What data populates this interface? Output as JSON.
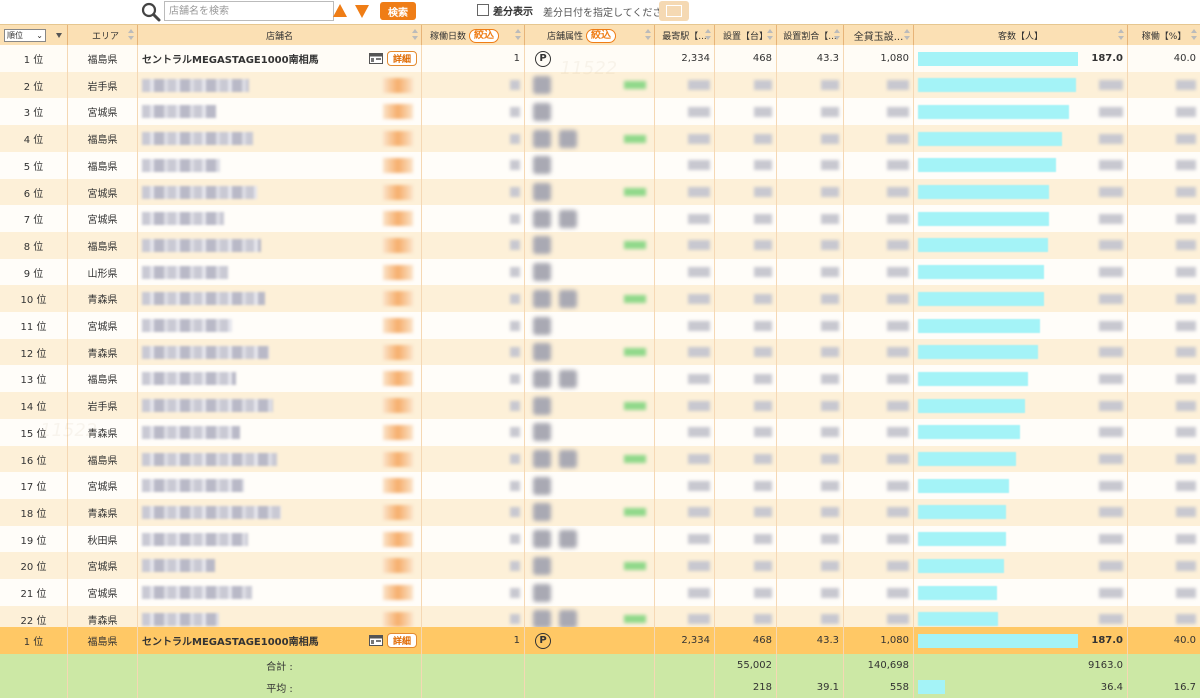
{
  "toolbar": {
    "search_placeholder": "店舗名を検索",
    "search_button": "検索",
    "diff_label": "差分表示",
    "diff_hint": "差分日付を指定してください"
  },
  "columns": {
    "rank": "順位",
    "area": "エリア",
    "name": "店舗名",
    "days": "稼働日数",
    "days_filter": "絞込",
    "attr": "店舗属性",
    "attr_filter": "絞込",
    "station": "最寄駅【...",
    "machines": "設置【台】",
    "ratio": "設置割合【...",
    "rental": "全貸玉設...",
    "customers": "客数【人】",
    "rate": "稼働【%】"
  },
  "detail_label": "詳細",
  "rows": [
    {
      "rank": "1 位",
      "area": "福島県",
      "name": "セントラルMEGASTAGE1000南相馬",
      "days": "1",
      "station": "2,334",
      "machines": "468",
      "ratio": "43.3",
      "rental": "1,080",
      "customers": "187.0",
      "customer_ratio": 1.0,
      "rate": "40.0"
    },
    {
      "rank": "2 位",
      "area": "岩手県",
      "customer_ratio": 0.985
    },
    {
      "rank": "3 位",
      "area": "宮城県",
      "customer_ratio": 0.945
    },
    {
      "rank": "4 位",
      "area": "福島県",
      "customer_ratio": 0.897
    },
    {
      "rank": "5 位",
      "area": "福島県",
      "customer_ratio": 0.864
    },
    {
      "rank": "6 位",
      "area": "宮城県",
      "customer_ratio": 0.818
    },
    {
      "rank": "7 位",
      "area": "宮城県",
      "customer_ratio": 0.818
    },
    {
      "rank": "8 位",
      "area": "福島県",
      "customer_ratio": 0.811
    },
    {
      "rank": "9 位",
      "area": "山形県",
      "customer_ratio": 0.786
    },
    {
      "rank": "10 位",
      "area": "青森県",
      "customer_ratio": 0.786
    },
    {
      "rank": "11 位",
      "area": "宮城県",
      "customer_ratio": 0.761
    },
    {
      "rank": "12 位",
      "area": "青森県",
      "customer_ratio": 0.748
    },
    {
      "rank": "13 位",
      "area": "福島県",
      "customer_ratio": 0.686
    },
    {
      "rank": "14 位",
      "area": "岩手県",
      "customer_ratio": 0.667
    },
    {
      "rank": "15 位",
      "area": "青森県",
      "customer_ratio": 0.635
    },
    {
      "rank": "16 位",
      "area": "福島県",
      "customer_ratio": 0.61
    },
    {
      "rank": "17 位",
      "area": "宮城県",
      "customer_ratio": 0.566
    },
    {
      "rank": "18 位",
      "area": "青森県",
      "customer_ratio": 0.553
    },
    {
      "rank": "19 位",
      "area": "秋田県",
      "customer_ratio": 0.553
    },
    {
      "rank": "20 位",
      "area": "宮城県",
      "customer_ratio": 0.535
    },
    {
      "rank": "21 位",
      "area": "宮城県",
      "customer_ratio": 0.491
    },
    {
      "rank": "22 位",
      "area": "青森県",
      "customer_ratio": 0.497
    }
  ],
  "pinned": {
    "rank": "1 位",
    "area": "福島県",
    "name": "セントラルMEGASTAGE1000南相馬",
    "days": "1",
    "station": "2,334",
    "machines": "468",
    "ratio": "43.3",
    "rental": "1,080",
    "customers": "187.0",
    "customer_ratio": 1.0,
    "rate": "40.0"
  },
  "total": {
    "label": "合計 :",
    "machines": "55,002",
    "rental": "140,698",
    "customers": "9163.0"
  },
  "average": {
    "label": "平均 :",
    "machines": "218",
    "ratio": "39.1",
    "rental": "558",
    "customers": "36.4",
    "customer_ratio": 0.17,
    "rate": "16.7"
  },
  "colors": {
    "accent": "#ef7d16",
    "header": "#fbe0b4",
    "pinned": "#ffc865",
    "summary": "#cce8a5",
    "bar": "#a4f3f7"
  }
}
